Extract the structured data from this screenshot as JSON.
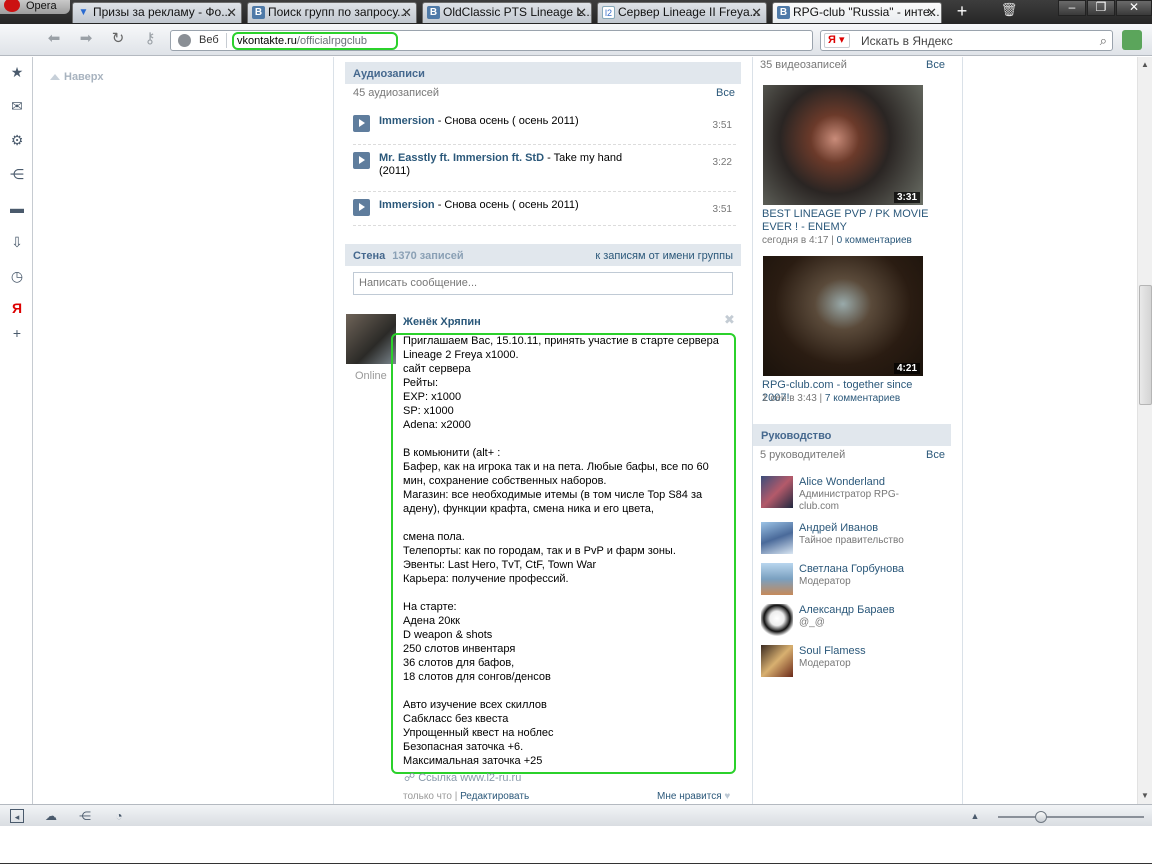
{
  "browser": {
    "menu_label": "Opera",
    "tabs": [
      {
        "label": "Призы за рекламу - Фо...",
        "close": "✕"
      },
      {
        "label": "Поиск групп по запросу...",
        "close": "✕",
        "favicon": "В"
      },
      {
        "label": "OldClassic PTS Lineage L...",
        "close": "✕",
        "favicon": "В"
      },
      {
        "label": "Сервер Lineage II Freya...",
        "close": "✕",
        "favicon": "l2"
      },
      {
        "label": "RPG-club \"Russia\" - инте...",
        "close": "✕",
        "favicon": "В"
      }
    ],
    "address": {
      "scope": "Веб",
      "host": "vkontakte.ru",
      "path": "/officialrpgclub"
    },
    "search": {
      "engine": "Я",
      "placeholder": "Искать в Яндекс"
    }
  },
  "page": {
    "up_label": "Наверх",
    "audio": {
      "header": "Аудиозаписи",
      "count": "45 аудиозаписей",
      "all": "Все",
      "tracks": [
        {
          "artist": "Immersion",
          "title": " - Снова осень ( осень 2011)",
          "duration": "3:51"
        },
        {
          "artist": "Mr. Easstly ft. Immersion ft. StD",
          "title": " - Take my hand (2011)",
          "duration": "3:22"
        },
        {
          "artist": "Immersion",
          "title": " - Снова осень ( осень 2011)",
          "duration": "3:51"
        }
      ]
    },
    "wall": {
      "header": "Стена",
      "count": "1370 записей",
      "filter": "к записям от имени группы",
      "input_placeholder": "Написать сообщение..."
    },
    "post": {
      "author": "Женёк Хряпин",
      "status": "Online",
      "lines": [
        "Приглашаем Вас, 15.10.11, принять участие в старте сервера",
        "Lineage 2 Freya x1000.",
        "сайт сервера",
        "Рейты:",
        "EXP: x1000",
        "SP: x1000",
        "Adena: x2000",
        "",
        "В комьюнити (alt+ :",
        "Бафер, как на игрока так и на пета. Любые бафы, все по 60",
        "мин, сохранение собственных наборов.",
        "Магазин: все необходимые итемы (в том числе Top S84 за",
        "адену), функции крафта, смена ника и его цвета,",
        "",
        "смена пола.",
        "Телепорты: как по городам, так и в PvP и фарм зоны.",
        "Эвенты: Last Hero, TvT, CtF, Town War",
        "Карьера: получение профессий.",
        "",
        "На старте:",
        "Адена 20кк",
        "D weapon & shots",
        "250 слотов инвентаря",
        "36 слотов для бафов,",
        "18 слотов для сонгов/денсов",
        "",
        "Авто изучение всех скиллов",
        "Сабкласс без квеста",
        "Упрощенный квест на ноблес",
        "Безопасная заточка +6.",
        "Максимальная заточка +25"
      ],
      "link": "Ссылка www.l2-ru.ru",
      "time": "только что",
      "edit": "Редактировать",
      "like": "Мне нравится"
    },
    "videos": {
      "count": "35 видеозаписей",
      "all": "Все",
      "items": [
        {
          "duration": "3:31",
          "title": "BEST LINEAGE PVP / PK MOVIE EVER ! - ENEMY",
          "date": "сегодня в 4:17",
          "comments": "0 комментариев"
        },
        {
          "duration": "4:21",
          "title": "RPG-club.com - together since 2007!",
          "date": "1 сен в 3:43",
          "comments": "7 комментариев"
        }
      ]
    },
    "leaders": {
      "header": "Руководство",
      "count": "5 руководителей",
      "all": "Все",
      "items": [
        {
          "name": "Alice Wonderland",
          "role": "Администратор RPG-club.com"
        },
        {
          "name": "Андрей Иванов",
          "role": "Тайное правительство"
        },
        {
          "name": "Светлана Горбунова",
          "role": "Модератор"
        },
        {
          "name": "Александр Бараев",
          "role": "@_@"
        },
        {
          "name": "Soul Flamess",
          "role": "Модератор"
        }
      ]
    }
  },
  "colors": {
    "accent": "#2b587a",
    "header_bg": "#e1e7ed",
    "highlight": "#2bd12b"
  }
}
